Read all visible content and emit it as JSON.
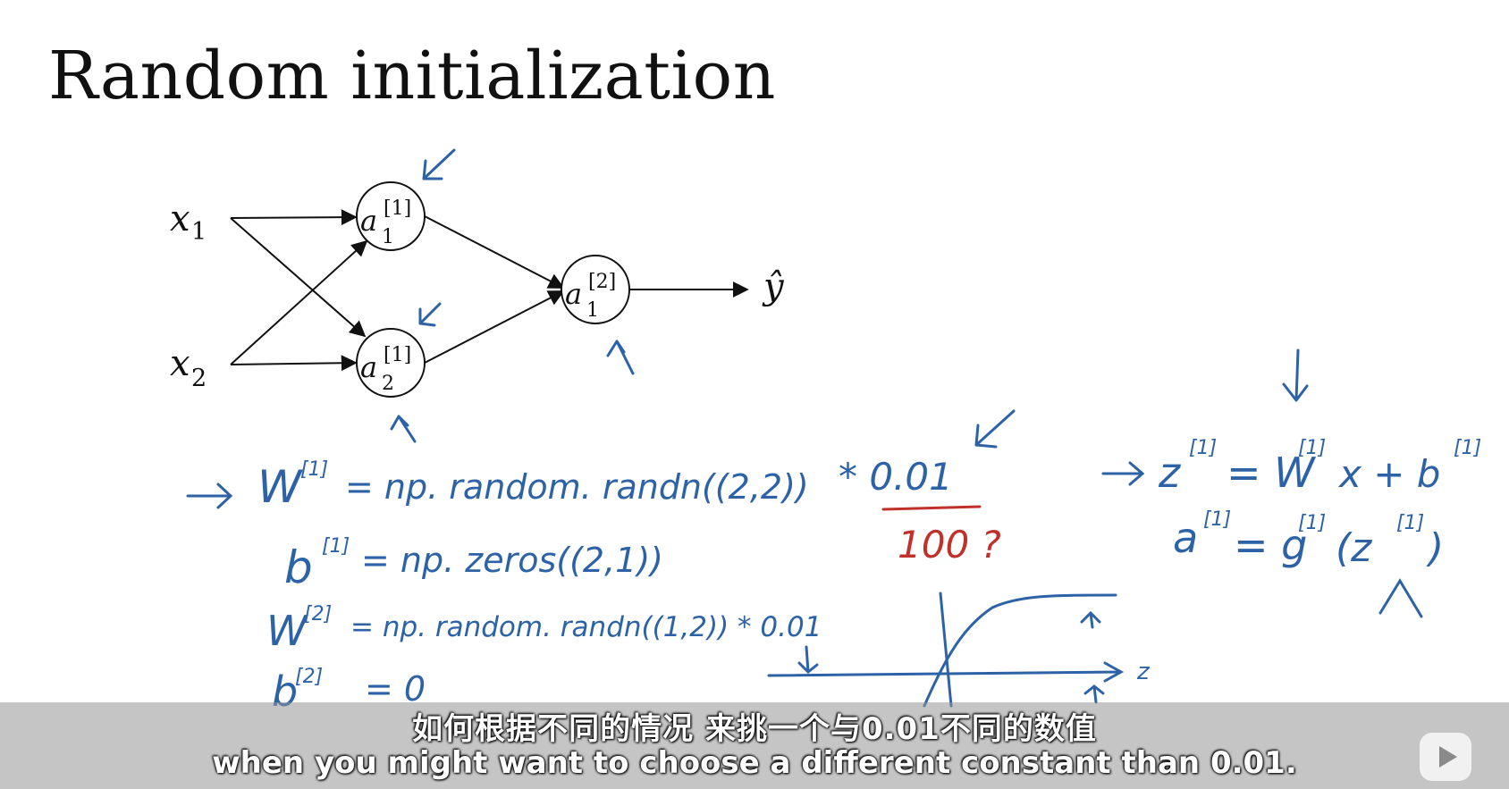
{
  "slide": {
    "title": "Random initialization"
  },
  "network": {
    "inputs": {
      "x1": "x",
      "x1_sub": "1",
      "x2": "x",
      "x2_sub": "2"
    },
    "hidden1": {
      "base": "a",
      "sub": "1",
      "sup": "[1]"
    },
    "hidden2": {
      "base": "a",
      "sub": "2",
      "sup": "[1]"
    },
    "output_node": {
      "base": "a",
      "sub": "1",
      "sup": "[2]"
    },
    "output_label": "ŷ"
  },
  "handwriting": {
    "line1": {
      "lhs": "W",
      "sup": "[1]",
      "rhs": "= np. random. randn((2,2))",
      "scale": "* 0.01"
    },
    "correction": "100 ?",
    "line2": {
      "lhs": "b",
      "sup": "[1]",
      "rhs": "= np. zeros((2,1))"
    },
    "line3": {
      "lhs": "W",
      "sup": "[2]",
      "rhs": "= np. random. randn((1,2)) * 0.01"
    },
    "line4": {
      "lhs": "b",
      "sup": "[2]",
      "rhs": "= 0"
    },
    "eq1": {
      "text": "z",
      "sup1": "[1]",
      "mid": "= W",
      "sup2": "[1]",
      "tail": "x + b",
      "sup3": "[1]"
    },
    "eq2": {
      "text": "a",
      "sup1": "[1]",
      "mid": "= g",
      "sup2": "[1]",
      "tail": "(z",
      "sup3": "[1]",
      "close": ")"
    },
    "axis_label": "z"
  },
  "subtitles": {
    "chinese": "如何根据不同的情况 来挑一个与0.01不同的数值",
    "english": "when you might want to choose a different constant than 0.01."
  },
  "colors": {
    "ink_blue": "#2d63a6",
    "ink_red": "#c0312b",
    "text_black": "#111111"
  },
  "icons": {
    "player_logo": "play-icon"
  }
}
